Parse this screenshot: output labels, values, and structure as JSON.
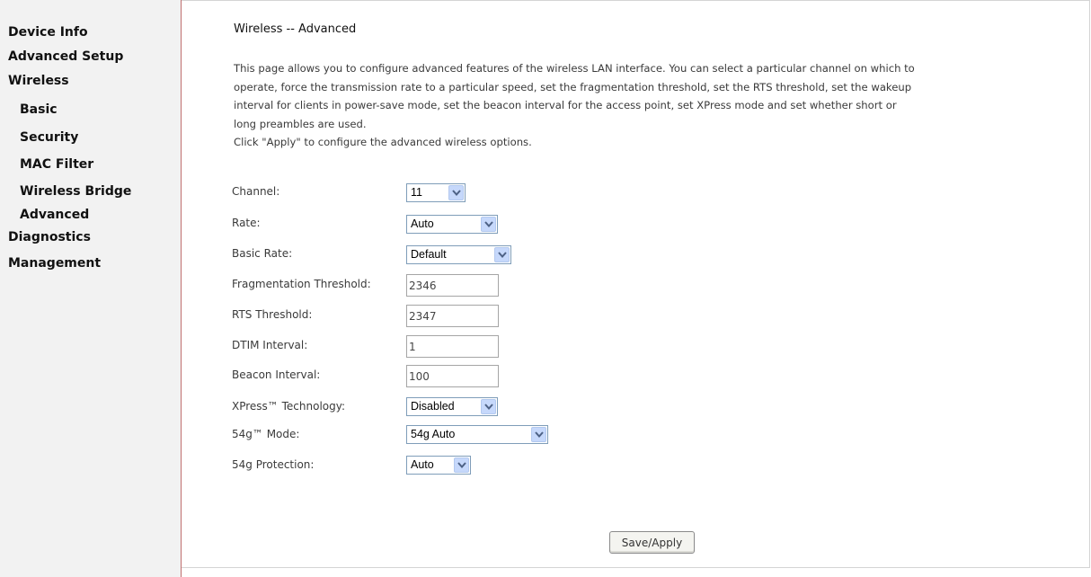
{
  "sidebar": {
    "items": [
      {
        "label": "Device Info"
      },
      {
        "label": "Advanced Setup"
      },
      {
        "label": "Wireless"
      },
      {
        "label": "Basic"
      },
      {
        "label": "Security"
      },
      {
        "label": "MAC Filter"
      },
      {
        "label": "Wireless Bridge"
      },
      {
        "label": "Advanced"
      },
      {
        "label": "Diagnostics"
      },
      {
        "label": "Management"
      }
    ]
  },
  "main": {
    "title": "Wireless -- Advanced",
    "description_lines": [
      "This page allows you to configure advanced features of the wireless LAN interface. You can select a particular channel on which to",
      "operate, force the transmission rate to a particular speed, set the fragmentation threshold, set the RTS threshold, set the wakeup",
      "interval for clients in power-save mode, set the beacon interval for the access point, set XPress mode and set whether short or",
      "long preambles are used.",
      "Click \"Apply\" to configure the advanced wireless options."
    ],
    "fields": {
      "channel": {
        "label": "Channel:",
        "value": "11"
      },
      "rate": {
        "label": "Rate:",
        "value": "Auto"
      },
      "basic_rate": {
        "label": "Basic Rate:",
        "value": "Default"
      },
      "fragmentation_threshold": {
        "label": "Fragmentation Threshold:",
        "value": "2346"
      },
      "rts_threshold": {
        "label": "RTS Threshold:",
        "value": "2347"
      },
      "dtim_interval": {
        "label": "DTIM Interval:",
        "value": "1"
      },
      "beacon_interval": {
        "label": "Beacon Interval:",
        "value": "100"
      },
      "xpress": {
        "label": "XPress™ Technology:",
        "value": "Disabled"
      },
      "mode_54g": {
        "label": "54g™ Mode:",
        "value": "54g Auto"
      },
      "protection_54g": {
        "label": "54g Protection:",
        "value": "Auto"
      }
    },
    "save_label": "Save/Apply"
  }
}
